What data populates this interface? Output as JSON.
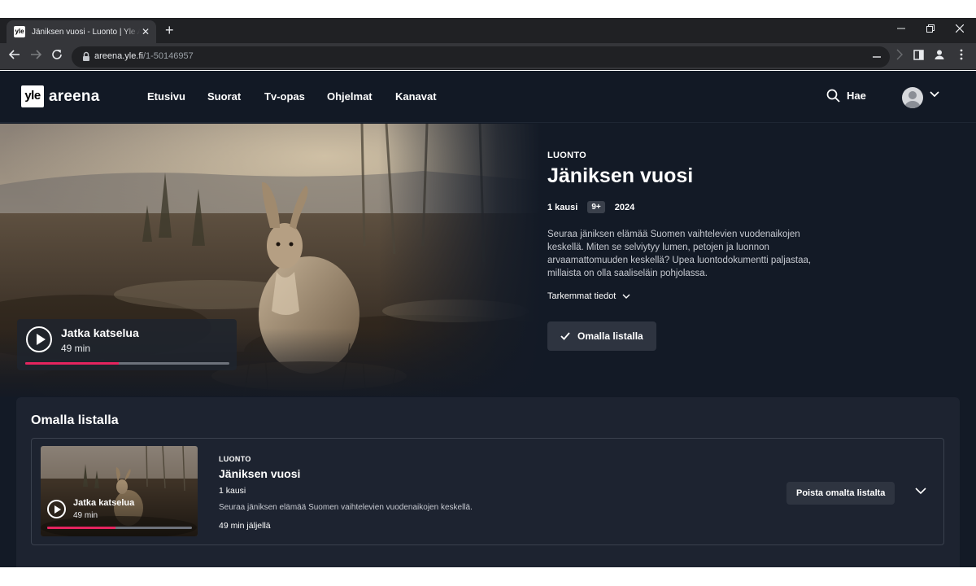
{
  "browser": {
    "tab_title": "Jäniksen vuosi - Luonto | Yle Areena",
    "favicon_text": "yle",
    "new_tab": "+",
    "close_tab": "✕",
    "url_host": "areena.yle.fi",
    "url_path": "/1-50146957"
  },
  "nav": {
    "logo_yle": "yle",
    "logo_areena": "areena",
    "items": [
      "Etusivu",
      "Suorat",
      "Tv-opas",
      "Ohjelmat",
      "Kanavat"
    ],
    "search_label": "Hae"
  },
  "hero": {
    "continue_title": "Jatka katselua",
    "continue_duration": "49 min",
    "progress": 0.46,
    "category": "LUONTO",
    "title": "Jäniksen vuosi",
    "seasons": "1 kausi",
    "age_rating": "9+",
    "year": "2024",
    "description": "Seuraa jäniksen elämää Suomen vaihtelevien vuodenaikojen keskellä. Miten se selviytyy lumen, petojen ja luonnon arvaamattomuuden keskellä? Upea luontodokumentti paljastaa, millaista on olla saaliseläin pohjolassa.",
    "details_label": "Tarkemmat tiedot",
    "list_button": "Omalla listalla"
  },
  "my_list": {
    "section_title": "Omalla listalla",
    "item": {
      "thumb_title": "Jatka katselua",
      "thumb_duration": "49 min",
      "progress": 0.47,
      "category": "LUONTO",
      "title": "Jäniksen vuosi",
      "seasons": "1 kausi",
      "description": "Seuraa jäniksen elämää Suomen vaihtelevien vuodenaikojen keskellä.",
      "remaining": "49 min jäljellä",
      "remove_button": "Poista omalta listalta"
    }
  },
  "colors": {
    "background": "#131a26",
    "panel": "#1d2330",
    "button": "#2e3440",
    "progress": "#e5245f"
  }
}
